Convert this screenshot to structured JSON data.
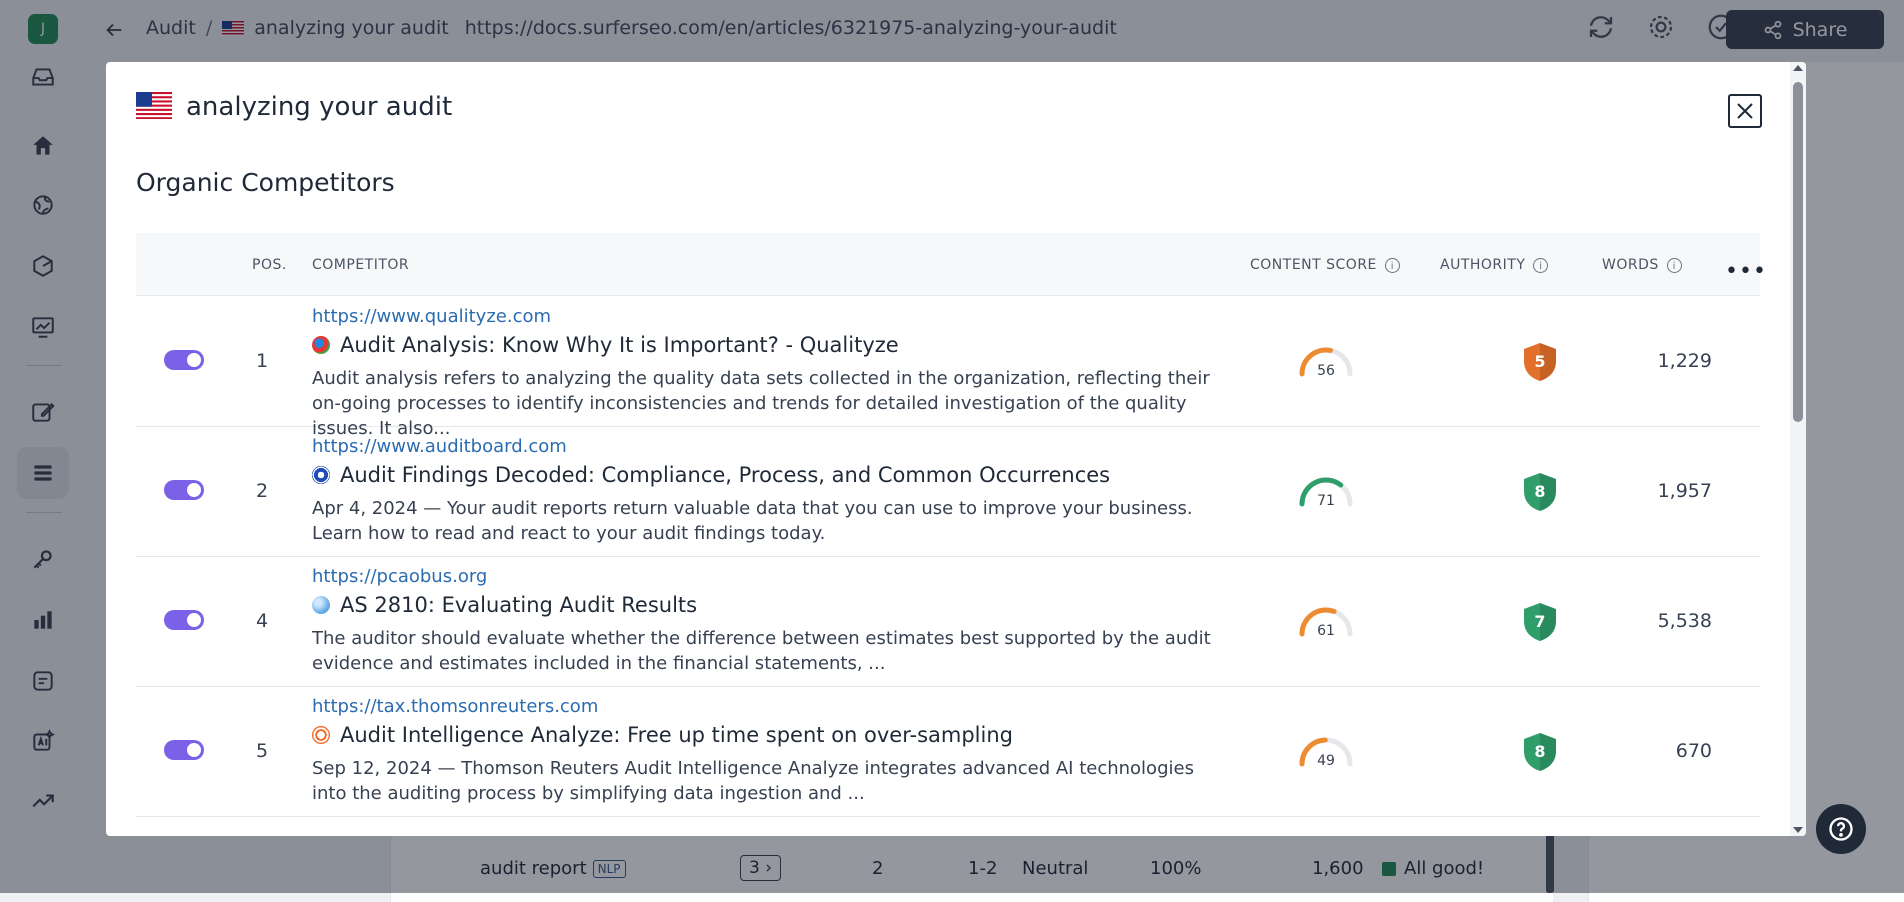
{
  "sidebar": {
    "avatar_letter": "J",
    "icons": [
      "inbox-icon",
      "home-icon",
      "globe-icon",
      "hexagon-icon",
      "chart-board-icon",
      "edit-icon",
      "stack-icon",
      "key-icon",
      "bar-chart-icon",
      "document-icon",
      "ai-icon",
      "trend-icon"
    ]
  },
  "topbar": {
    "breadcrumb_root": "Audit",
    "breadcrumb_sep": "/",
    "breadcrumb_page": "analyzing your audit",
    "url": "https://docs.surferseo.com/en/articles/6321975-analyzing-your-audit",
    "share_label": "Share"
  },
  "background": {
    "row": {
      "keyword": "audit report",
      "badge": "NLP",
      "count": "3",
      "col1": "2",
      "col2": "1-2",
      "sentiment": "Neutral",
      "percent": "100%",
      "volume": "1,600",
      "status": "All good!"
    }
  },
  "modal": {
    "title": "analyzing your audit",
    "section_title": "Organic Competitors",
    "columns": {
      "pos": "POS.",
      "competitor": "COMPETITOR",
      "content_score": "CONTENT SCORE",
      "authority": "AUTHORITY",
      "words": "WORDS"
    },
    "rows": [
      {
        "pos": "1",
        "url": "https://www.qualityze.com",
        "title": "Audit Analysis: Know Why It is Important? - Qualityze",
        "desc": "Audit analysis refers to analyzing the quality data sets collected in the organization, reflecting their on-going processes to identify inconsistencies and trends for detailed investigation of the quality issues. It also...",
        "content_score": 56,
        "authority": "5",
        "words": "1,229"
      },
      {
        "pos": "2",
        "url": "https://www.auditboard.com",
        "title": "Audit Findings Decoded: Compliance, Process, and Common Occurrences",
        "desc": "Apr 4, 2024 — Your audit reports return valuable data that you can use to improve your business. Learn how to read and react to your audit findings today.",
        "content_score": 71,
        "authority": "8",
        "words": "1,957"
      },
      {
        "pos": "4",
        "url": "https://pcaobus.org",
        "title": "AS 2810: Evaluating Audit Results",
        "desc": "The auditor should evaluate whether the difference between estimates best supported by the audit evidence and estimates included in the financial statements, ...",
        "content_score": 61,
        "authority": "7",
        "words": "5,538"
      },
      {
        "pos": "5",
        "url": "https://tax.thomsonreuters.com",
        "title": "Audit Intelligence Analyze: Free up time spent on over-sampling",
        "desc": "Sep 12, 2024 — Thomson Reuters Audit Intelligence Analyze integrates advanced AI technologies into the auditing process by simplifying data ingestion and ...",
        "content_score": 49,
        "authority": "8",
        "words": "670"
      }
    ]
  },
  "colors": {
    "toggle": "#7b61e8",
    "link": "#2b6cb0",
    "score_orange": "#ec8b2f",
    "score_green": "#2f9e6a",
    "shield_orange": "#e2702a",
    "shield_green": "#2f9e6a"
  }
}
